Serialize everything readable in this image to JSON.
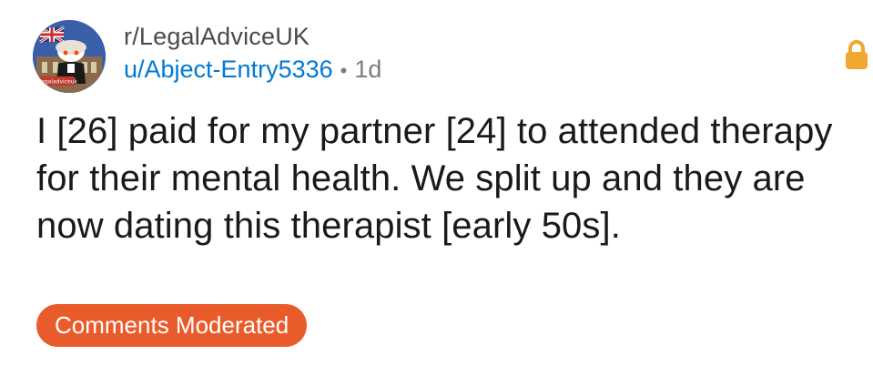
{
  "post": {
    "subreddit": "r/LegalAdviceUK",
    "author": "u/Abject-Entry5336",
    "separator": "•",
    "age": "1d",
    "title": "I [26] paid for my partner [24] to attended therapy for their mental health. We split up and they are now dating this therapist [early 50s].",
    "badge": "Comments Moderated",
    "locked_icon": "lock-icon"
  },
  "avatar": {
    "banner_text": "r/legaladviceuk"
  },
  "colors": {
    "author_link": "#0079d3",
    "badge_bg": "#ea5b2b",
    "lock": "#f0a830"
  }
}
